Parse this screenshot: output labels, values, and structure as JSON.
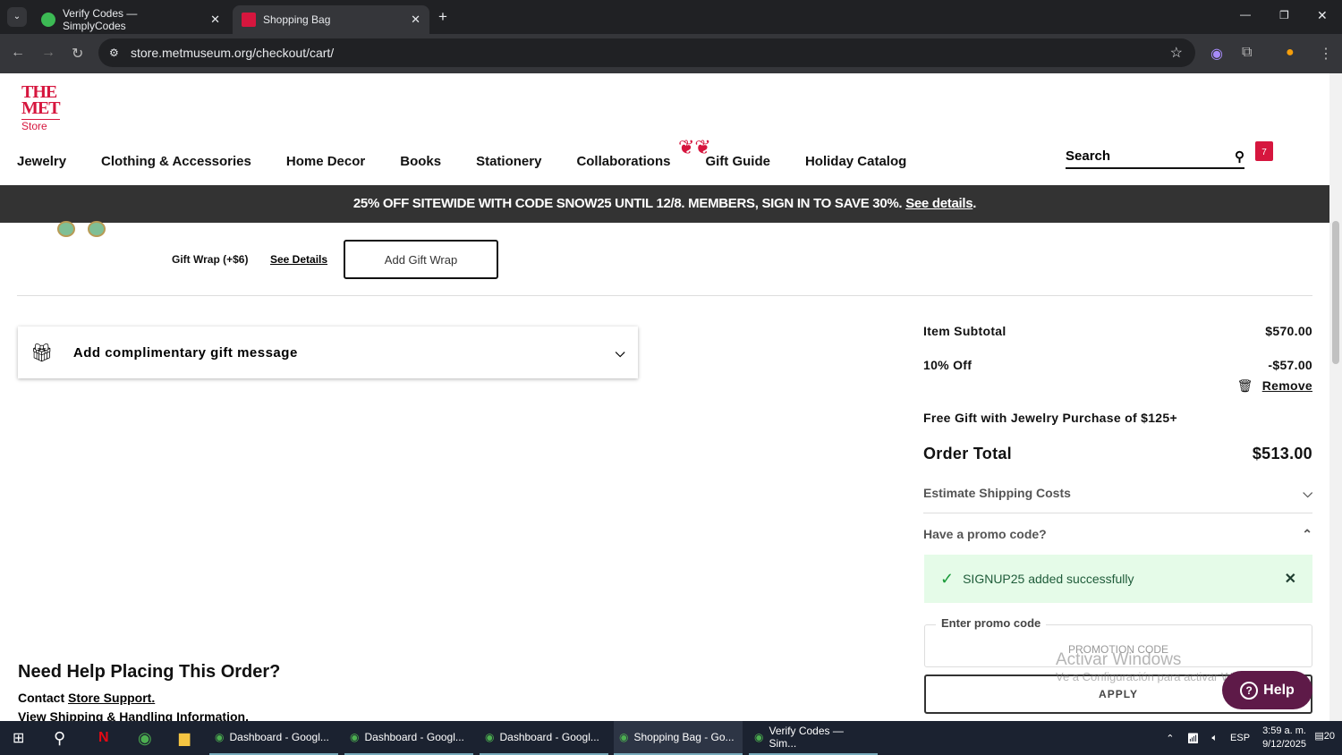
{
  "browser": {
    "tabs": [
      {
        "title": "Verify Codes — SimplyCodes",
        "active": false
      },
      {
        "title": "Shopping Bag",
        "active": true
      }
    ],
    "url": "store.metmuseum.org/checkout/cart/"
  },
  "header": {
    "logo_line1": "THE",
    "logo_line2": "MET",
    "logo_line3": "Store",
    "nav": [
      "Jewelry",
      "Clothing & Accessories",
      "Home Decor",
      "Books",
      "Stationery",
      "Collaborations",
      "Gift Guide",
      "Holiday Catalog"
    ],
    "search_label": "Search",
    "bag_count": "7"
  },
  "promo_banner": {
    "text": "25% OFF SITEWIDE WITH CODE SNOW25 UNTIL 12/8. MEMBERS, SIGN IN TO SAVE 30%.",
    "link": "See details",
    "end": "."
  },
  "gift_wrap": {
    "label": "Gift Wrap (+$6)",
    "see_details": "See Details",
    "button": "Add Gift Wrap"
  },
  "gift_message": {
    "label": "Add complimentary gift message"
  },
  "help": {
    "heading": "Need Help Placing This Order?",
    "contact_prefix": "Contact ",
    "contact_link": "Store Support.",
    "shipping_link": "View Shipping & Handling Information."
  },
  "summary": {
    "subtotal_label": "Item Subtotal",
    "subtotal": "$570.00",
    "discount_label": "10% Off",
    "discount": "-$57.00",
    "remove": "Remove",
    "free_gift": "Free Gift with Jewelry Purchase of $125+",
    "total_label": "Order Total",
    "total": "$513.00",
    "shipping": "Estimate Shipping Costs",
    "promo_q": "Have a promo code?",
    "success": "SIGNUP25 added successfully",
    "promo_label": "Enter promo code",
    "promo_placeholder": "PROMOTION CODE",
    "apply": "APPLY"
  },
  "help_button": "Help",
  "watermark": {
    "title": "Activar Windows",
    "sub": "Ve a Configuración para activar Windows."
  },
  "taskbar": {
    "apps": [
      "Dashboard - Googl...",
      "Dashboard - Googl...",
      "Dashboard - Googl...",
      "Shopping Bag - Go...",
      "Verify Codes — Sim..."
    ],
    "lang": "ESP",
    "time": "3:59 a. m.",
    "date": "9/12/2025",
    "notifications": "20"
  }
}
